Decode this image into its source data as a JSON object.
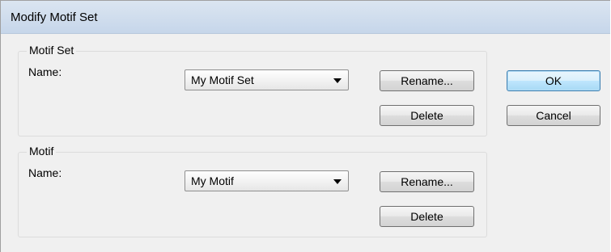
{
  "window": {
    "title": "Modify Motif Set"
  },
  "motif_set_group": {
    "legend": "Motif Set",
    "name_label": "Name:",
    "selected_value": "My Motif Set",
    "rename_label": "Rename...",
    "delete_label": "Delete"
  },
  "motif_group": {
    "legend": "Motif",
    "name_label": "Name:",
    "selected_value": "My Motif",
    "rename_label": "Rename...",
    "delete_label": "Delete"
  },
  "dialog_buttons": {
    "ok_label": "OK",
    "cancel_label": "Cancel"
  },
  "icons": {
    "dropdown": "chevron-down-icon"
  },
  "colors": {
    "titlebar": "#c6d6ea",
    "dialog_bg": "#f0f0f0",
    "default_button_border": "#3c7fb1"
  }
}
